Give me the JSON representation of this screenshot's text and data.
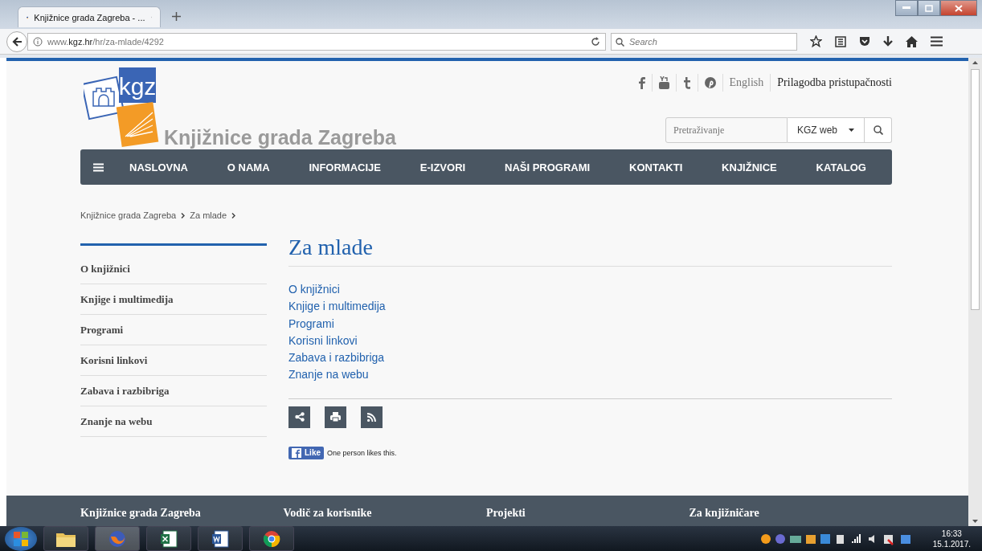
{
  "browser": {
    "tab_title": "Knjižnice grada Zagreba - ...",
    "url": "www.**kgz.hr**/hr/za-mlade/4292",
    "search_placeholder": "Search"
  },
  "header": {
    "top_links": [
      "English",
      "Prilagodba pristupačnosti"
    ],
    "logo_text": "kgz",
    "site_title": "Knjižnice grada Zagreba",
    "search": {
      "placeholder": "Pretraživanje",
      "scope": "KGZ web"
    }
  },
  "nav": {
    "items": [
      "NASLOVNA",
      "O NAMA",
      "INFORMACIJE",
      "E-IZVORI",
      "NAŠI PROGRAMI",
      "KONTAKTI",
      "KNJIŽNICE",
      "KATALOG"
    ]
  },
  "breadcrumb": [
    "Knjižnice grada Zagreba",
    "Za mlade"
  ],
  "sidebar": {
    "items": [
      "O knjižnici",
      "Knjige i multimedija",
      "Programi",
      "Korisni linkovi",
      "Zabava i razbibriga",
      "Znanje na webu"
    ]
  },
  "main": {
    "title": "Za mlade",
    "links": [
      "O knjižnici",
      "Knjige i multimedija",
      "Programi",
      "Korisni linkovi",
      "Zabava i razbibriga",
      "Znanje na webu"
    ],
    "like": {
      "button": "Like",
      "text": "One person likes this."
    }
  },
  "footer": {
    "columns": [
      "Knjižnice grada Zagreba",
      "Vodič za korisnike",
      "Projekti",
      "Za knjižničare"
    ]
  },
  "taskbar": {
    "time": "16:33",
    "date": "15.1.2017."
  }
}
